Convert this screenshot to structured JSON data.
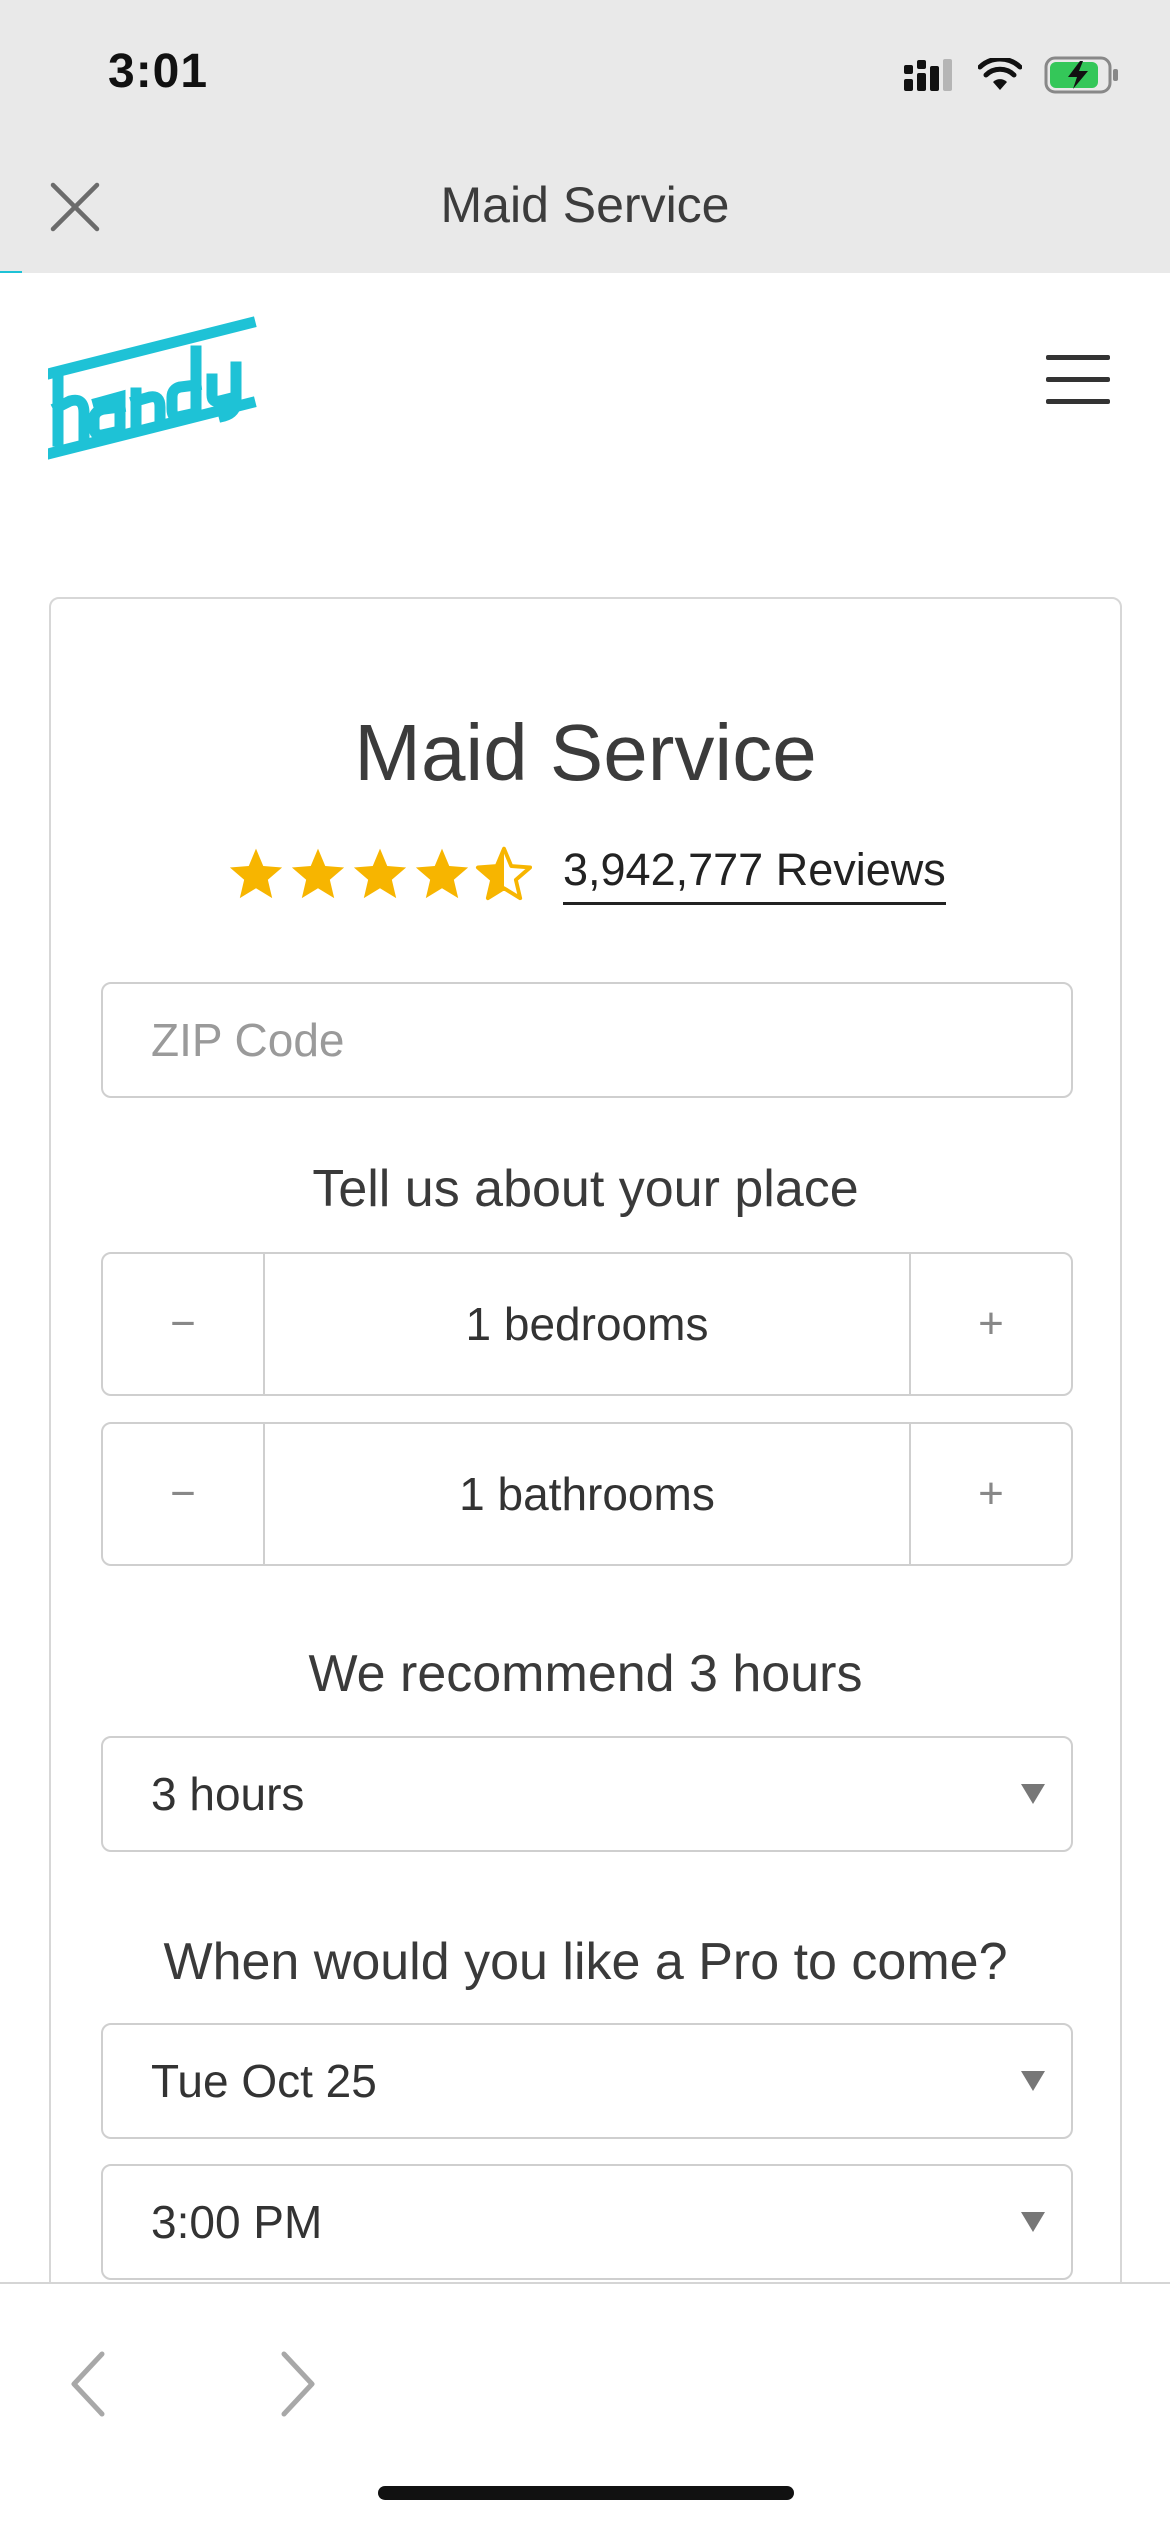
{
  "status_bar": {
    "time": "3:01"
  },
  "nav": {
    "title": "Maid Service"
  },
  "brand": {
    "name": "handy",
    "color": "#1ec2d6"
  },
  "card": {
    "title": "Maid Service",
    "rating": 4.5,
    "reviews_label": "3,942,777 Reviews",
    "zip_placeholder": "ZIP Code",
    "place_label": "Tell us about your place",
    "bedrooms_value": "1 bedrooms",
    "bathrooms_value": "1 bathrooms",
    "minus_label": "−",
    "plus_label": "+",
    "recommend_label": "We recommend 3 hours",
    "hours_value": "3 hours",
    "when_label": "When would you like a Pro to come?",
    "date_value": "Tue Oct 25",
    "time_value": "3:00 PM"
  },
  "colors": {
    "star": "#f7b500",
    "accent": "#1ec2d6"
  }
}
